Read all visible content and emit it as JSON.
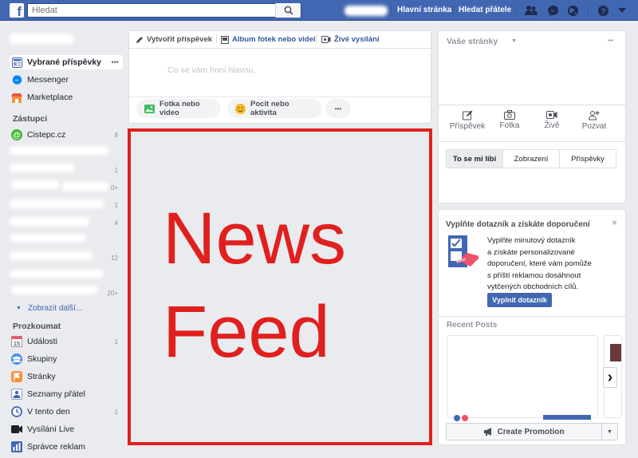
{
  "topbar": {
    "logo": "f",
    "search_placeholder": "Hledat",
    "nav_home": "Hlavní stránka",
    "nav_find_friends": "Hledat přátele",
    "icons": [
      "friends-icon",
      "messenger-icon",
      "globe-icon",
      "help-icon",
      "caret-down-icon"
    ]
  },
  "left": {
    "selected_item": "Vybrané příspěvky",
    "messenger": "Messenger",
    "marketplace": "Marketplace",
    "shortcuts_header": "Zástupci",
    "shortcut_first": "Cistepc.cz",
    "shortcut_first_count": "8",
    "shortcut_counts": [
      "1",
      "0+",
      "1",
      "4",
      "12",
      "20+"
    ],
    "show_more": "Zobrazit další...",
    "explore_header": "Prozkoumat",
    "explore": [
      {
        "label": "Události",
        "count": "1",
        "icon": "calendar-icon"
      },
      {
        "label": "Skupiny",
        "count": "",
        "icon": "groups-icon"
      },
      {
        "label": "Stránky",
        "count": "",
        "icon": "flag-icon"
      },
      {
        "label": "Seznamy přátel",
        "count": "",
        "icon": "friend-list-icon"
      },
      {
        "label": "V tento den",
        "count": "1",
        "icon": "clock-icon"
      },
      {
        "label": "Vysílání Live",
        "count": "",
        "icon": "video-icon"
      },
      {
        "label": "Správce reklam",
        "count": "",
        "icon": "chart-icon"
      }
    ]
  },
  "composer": {
    "tab_create": "Vytvořit příspěvek",
    "tab_album": "Album fotek nebo videí",
    "tab_live": "Živé vysílání",
    "placeholder": "Co se vám honí hlavou,",
    "btn_photo": "Fotka nebo video",
    "btn_feeling": "Pocit nebo aktivita",
    "btn_more": "•••"
  },
  "news_feed": {
    "line1": "News",
    "line2": "Feed",
    "color": "#e0201e"
  },
  "right": {
    "pages_title": "Vaše stránky",
    "more_dots": "•••",
    "actions": [
      "Příspěvek",
      "Fotka",
      "Živě",
      "Pozvat"
    ],
    "tabs": [
      "To se mi líbí",
      "Zobrazení",
      "Příspěvky"
    ],
    "survey_title": "Vyplňte dotazník a získáte doporučení",
    "survey_close": "×",
    "survey_text": [
      "Vyplňte minutový dotazník",
      "a získáte personalizované",
      "doporučení, které vám pomůže",
      "s příští reklamou dosáhnout",
      "vytčených obchodních cílů."
    ],
    "survey_button": "Vyplnit dotazník",
    "recent_title": "Recent Posts",
    "next_arrow": "›",
    "promo_button": "Create Promotion"
  },
  "colors": {
    "brand": "#4267b2",
    "accent_red": "#e0201e"
  }
}
